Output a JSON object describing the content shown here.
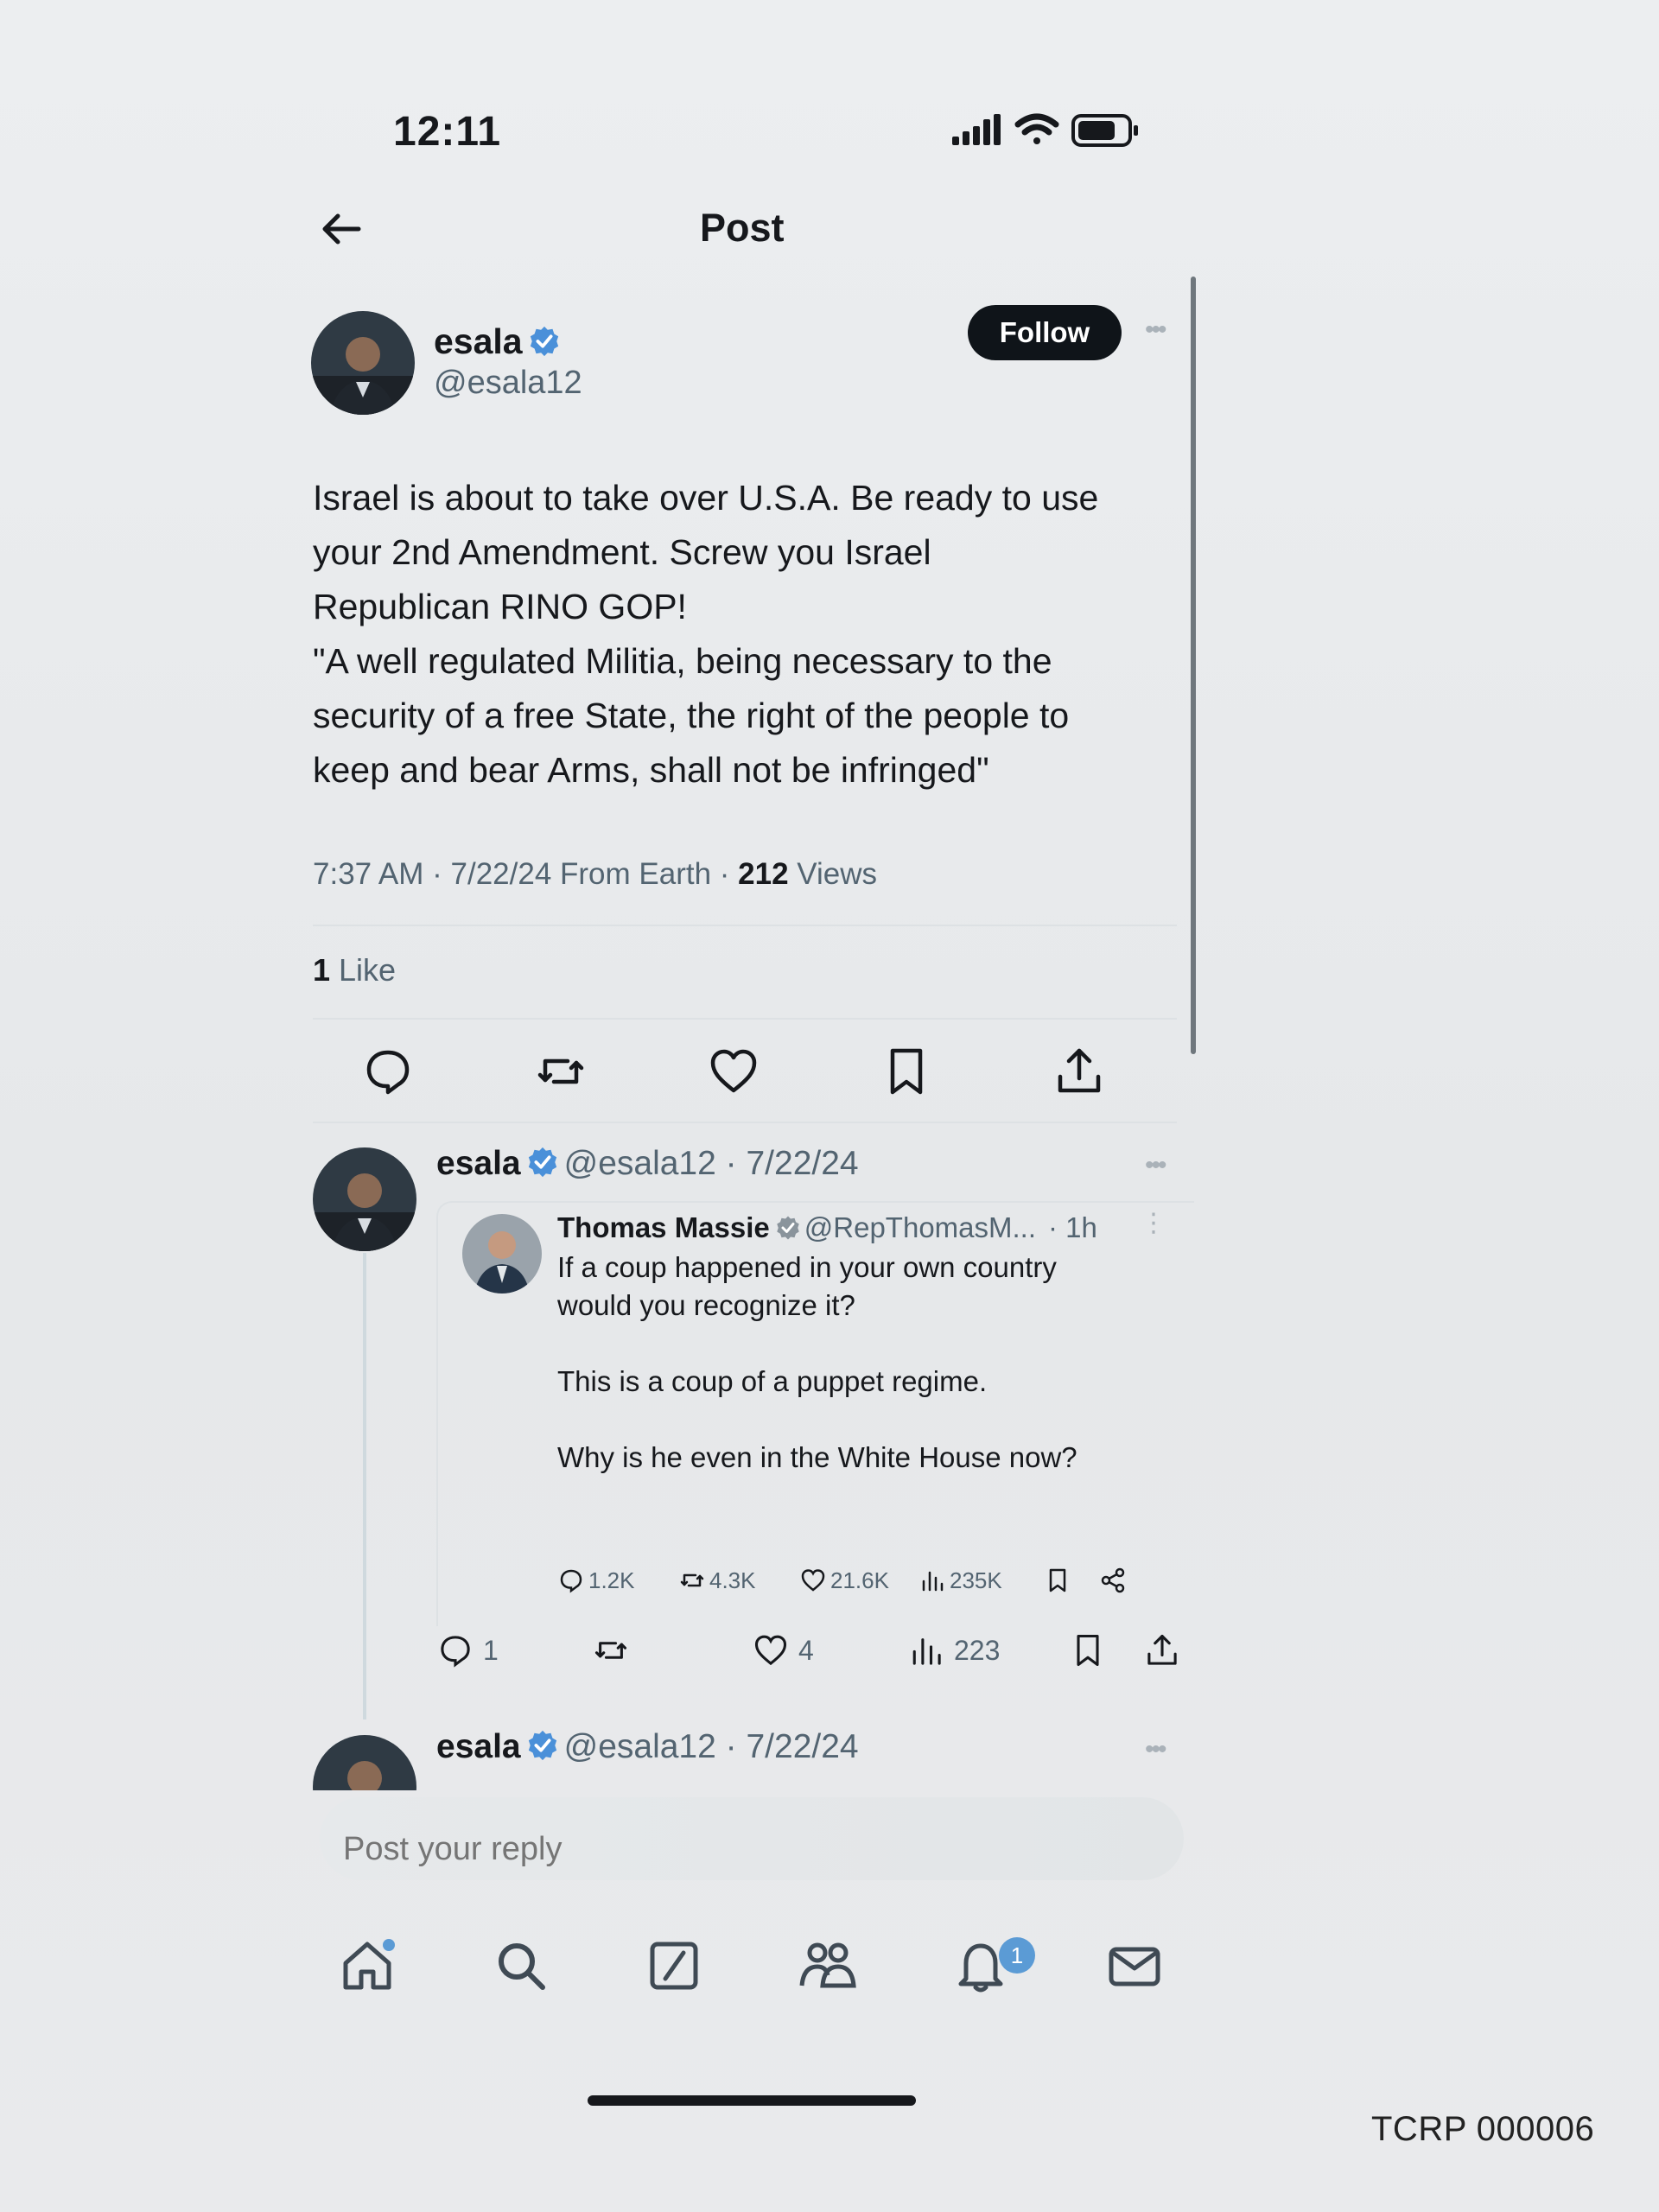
{
  "status_bar": {
    "time": "12:11"
  },
  "header": {
    "title": "Post"
  },
  "post": {
    "author_name": "esala",
    "author_handle": "@esala12",
    "follow_label": "Follow",
    "text": "Israel is about to take over U.S.A. Be ready to use\nyour 2nd Amendment. Screw you Israel\nRepublican RINO GOP!\n\"A well regulated Militia, being necessary to the\nsecurity of a free State, the right of the people to\nkeep and bear Arms, shall not be infringed\"",
    "meta_prefix": "7:37 AM · 7/22/24 From Earth · ",
    "views_count": "212",
    "views_label": " Views",
    "likes_count": "1",
    "likes_label": " Like"
  },
  "reply": {
    "author_name": "esala",
    "handle_date": "@esala12 · 7/22/24",
    "quote": {
      "author_name": "Thomas Massie",
      "author_handle": "@RepThomasM...",
      "time": "· 1h",
      "text": "If a coup happened in your own country\nwould you recognize it?\n\nThis is a coup of a puppet regime.\n\nWhy is he even in the White House now?",
      "replies": "1.2K",
      "reposts": "4.3K",
      "likes": "21.6K",
      "views": "235K"
    },
    "replies_count": "1",
    "likes_count": "4",
    "views_count": "223"
  },
  "reply2": {
    "author_name": "esala",
    "handle_date": "@esala12 · 7/22/24"
  },
  "compose": {
    "placeholder": "Post your reply"
  },
  "tabbar": {
    "notifications_badge": "1"
  },
  "footer": {
    "bates_number": "TCRP 000006"
  },
  "colors": {
    "accent": "#5b9bd5",
    "verified": "#4a90d9",
    "text": "#16181c",
    "muted": "#536471"
  }
}
